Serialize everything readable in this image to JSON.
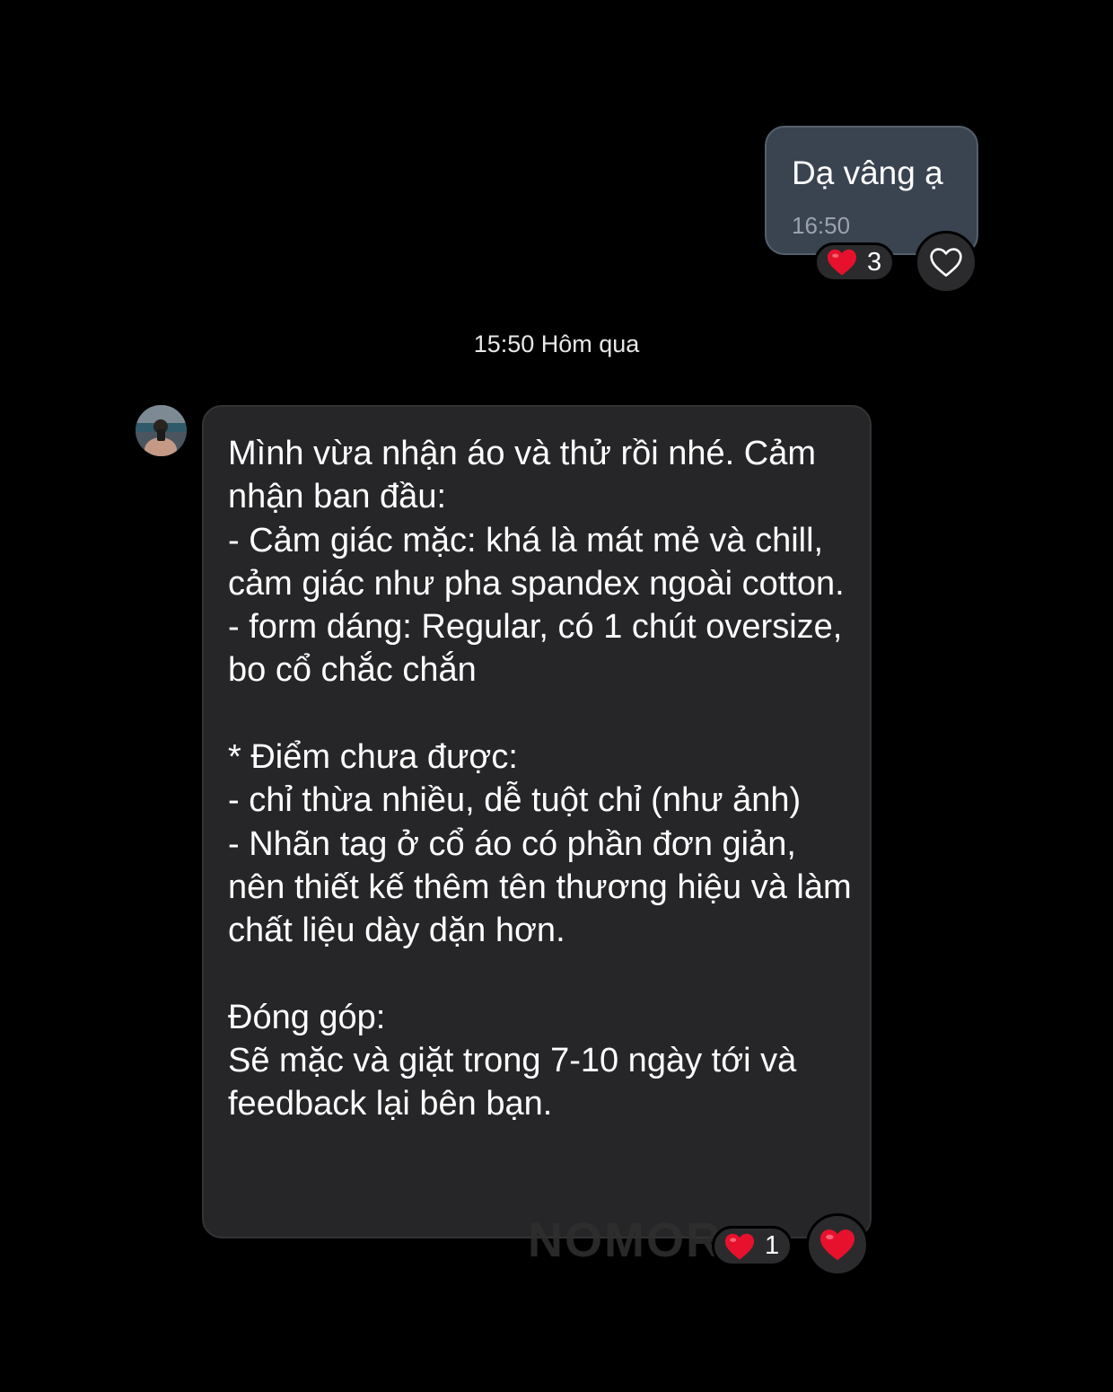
{
  "outgoing_message": {
    "text": "Dạ vâng ạ",
    "time": "16:50",
    "reaction": {
      "emoji": "heart-red",
      "count": "3"
    },
    "react_button_icon": "heart-outline-icon"
  },
  "separator": {
    "label": "15:50 Hôm qua"
  },
  "incoming_message": {
    "avatar_icon": "user-avatar",
    "text": "Mình vừa nhận áo và thử rồi nhé. Cảm nhận ban đầu:\n- Cảm giác mặc: khá là mát mẻ và chill, cảm giác như pha spandex ngoài cotton.\n- form dáng: Regular, có 1 chút oversize, bo cổ chắc chắn\n\n* Điểm chưa được:\n- chỉ thừa nhiều, dễ tuột chỉ (như ảnh)\n- Nhãn tag ở cổ áo có phần đơn giản, nên thiết kế thêm tên thương hiệu và làm chất liệu dày dặn hơn.\n\nĐóng góp:\nSẽ mặc và giặt trong 7-10 ngày tới và feedback lại bên bạn.",
    "reaction": {
      "emoji": "heart-red",
      "count": "1"
    },
    "react_button_icon": "heart-filled-icon"
  },
  "watermark": "NOMOR",
  "colors": {
    "background": "#000000",
    "outgoing_bubble": "#3a4350",
    "incoming_bubble": "#262628",
    "heart": "#e8112d"
  }
}
